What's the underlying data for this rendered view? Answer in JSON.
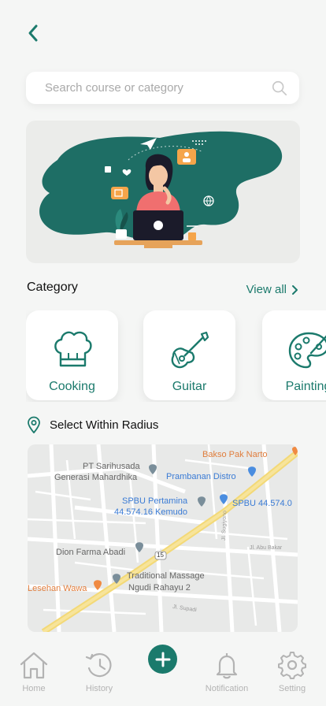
{
  "search": {
    "placeholder": "Search course or category"
  },
  "category": {
    "title": "Category",
    "view_all": "View all",
    "items": [
      {
        "label": "Cooking",
        "icon": "chef-hat-icon"
      },
      {
        "label": "Guitar",
        "icon": "guitar-icon"
      },
      {
        "label": "Painting",
        "icon": "paint-palette-icon"
      }
    ]
  },
  "radius": {
    "label": "Select Within Radius"
  },
  "map": {
    "places": [
      "Bakso Pak Narto",
      "PT Sarihusada",
      "Generasi Mahardhika",
      "Prambanan Distro",
      "SPBU Pertamina",
      "44.574.16 Kemudo",
      "SPBU 44.574.0",
      "Dion Farma Abadi",
      "Traditional Massage",
      "Ngudi Rahayu 2",
      "Lesehan Wawa"
    ],
    "roads": [
      "Jl. Sugiyono",
      "Jl. Abu Bakar",
      "Jl. Supadi"
    ],
    "route_badge": "15"
  },
  "nav": {
    "items": [
      {
        "label": "Home"
      },
      {
        "label": "History"
      },
      {
        "label": "Notification"
      },
      {
        "label": "Setting"
      }
    ]
  },
  "colors": {
    "accent": "#1b7a6c",
    "inactive": "#b3b3b3",
    "blob": "#1e6e65"
  }
}
